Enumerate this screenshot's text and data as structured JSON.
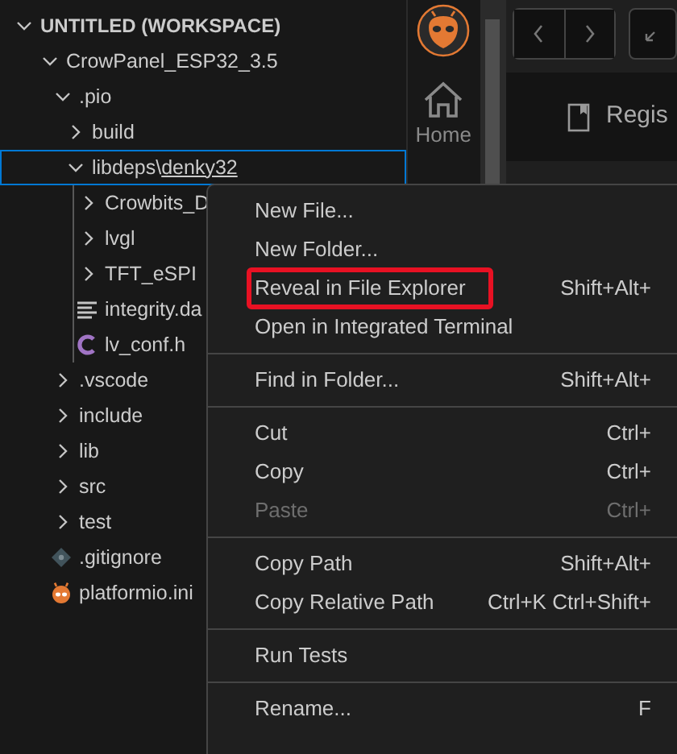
{
  "explorer": {
    "workspace": {
      "label": "UNTITLED (WORKSPACE)",
      "expanded": true
    },
    "tree": [
      {
        "label": "CrowPanel_ESP32_3.5",
        "kind": "folder",
        "expanded": true,
        "selected": false,
        "children": [
          {
            "label": ".pio",
            "kind": "folder",
            "expanded": true,
            "selected": false,
            "children": [
              {
                "label": "build",
                "kind": "folder",
                "expanded": false,
                "selected": false
              },
              {
                "label": "libdeps\\**denky32**",
                "kind": "folder",
                "expanded": true,
                "selected": true,
                "children": [
                  {
                    "label": "Crowbits_D",
                    "kind": "folder",
                    "expanded": false,
                    "selected": false
                  },
                  {
                    "label": "lvgl",
                    "kind": "folder",
                    "expanded": false,
                    "selected": false
                  },
                  {
                    "label": "TFT_eSPI",
                    "kind": "folder",
                    "expanded": false,
                    "selected": false
                  },
                  {
                    "label": "integrity.da",
                    "kind": "text-file",
                    "selected": false
                  },
                  {
                    "label": "lv_conf.h",
                    "kind": "c-file",
                    "selected": false
                  }
                ]
              }
            ]
          },
          {
            "label": ".vscode",
            "kind": "folder",
            "expanded": false,
            "selected": false
          },
          {
            "label": "include",
            "kind": "folder",
            "expanded": false,
            "selected": false
          },
          {
            "label": "lib",
            "kind": "folder",
            "expanded": false,
            "selected": false
          },
          {
            "label": "src",
            "kind": "folder",
            "expanded": false,
            "selected": false
          },
          {
            "label": "test",
            "kind": "folder",
            "expanded": false,
            "selected": false
          },
          {
            "label": ".gitignore",
            "kind": "git-file",
            "selected": false
          },
          {
            "label": "platformio.ini",
            "kind": "pio-file",
            "selected": false
          }
        ]
      }
    ]
  },
  "activity_bar": {
    "home_label": "Home"
  },
  "editor": {
    "tab_label": "Regis"
  },
  "context_menu": {
    "groups": [
      [
        {
          "label": "New File...",
          "disabled": false,
          "highlighted": false
        },
        {
          "label": "New Folder...",
          "disabled": false,
          "highlighted": false
        },
        {
          "label": "Reveal in File Explorer",
          "shortcut": "Shift+Alt+",
          "disabled": false,
          "highlighted": true
        },
        {
          "label": "Open in Integrated Terminal",
          "disabled": false,
          "highlighted": false
        }
      ],
      [
        {
          "label": "Find in Folder...",
          "shortcut": "Shift+Alt+",
          "disabled": false,
          "highlighted": false
        }
      ],
      [
        {
          "label": "Cut",
          "shortcut": "Ctrl+",
          "disabled": false,
          "highlighted": false
        },
        {
          "label": "Copy",
          "shortcut": "Ctrl+",
          "disabled": false,
          "highlighted": false
        },
        {
          "label": "Paste",
          "shortcut": "Ctrl+",
          "disabled": true,
          "highlighted": false
        }
      ],
      [
        {
          "label": "Copy Path",
          "shortcut": "Shift+Alt+",
          "disabled": false,
          "highlighted": false
        },
        {
          "label": "Copy Relative Path",
          "shortcut": "Ctrl+K Ctrl+Shift+",
          "disabled": false,
          "highlighted": false
        }
      ],
      [
        {
          "label": "Run Tests",
          "disabled": false,
          "highlighted": false
        }
      ],
      [
        {
          "label": "Rename...",
          "shortcut": "F",
          "disabled": false,
          "highlighted": false
        }
      ]
    ]
  }
}
